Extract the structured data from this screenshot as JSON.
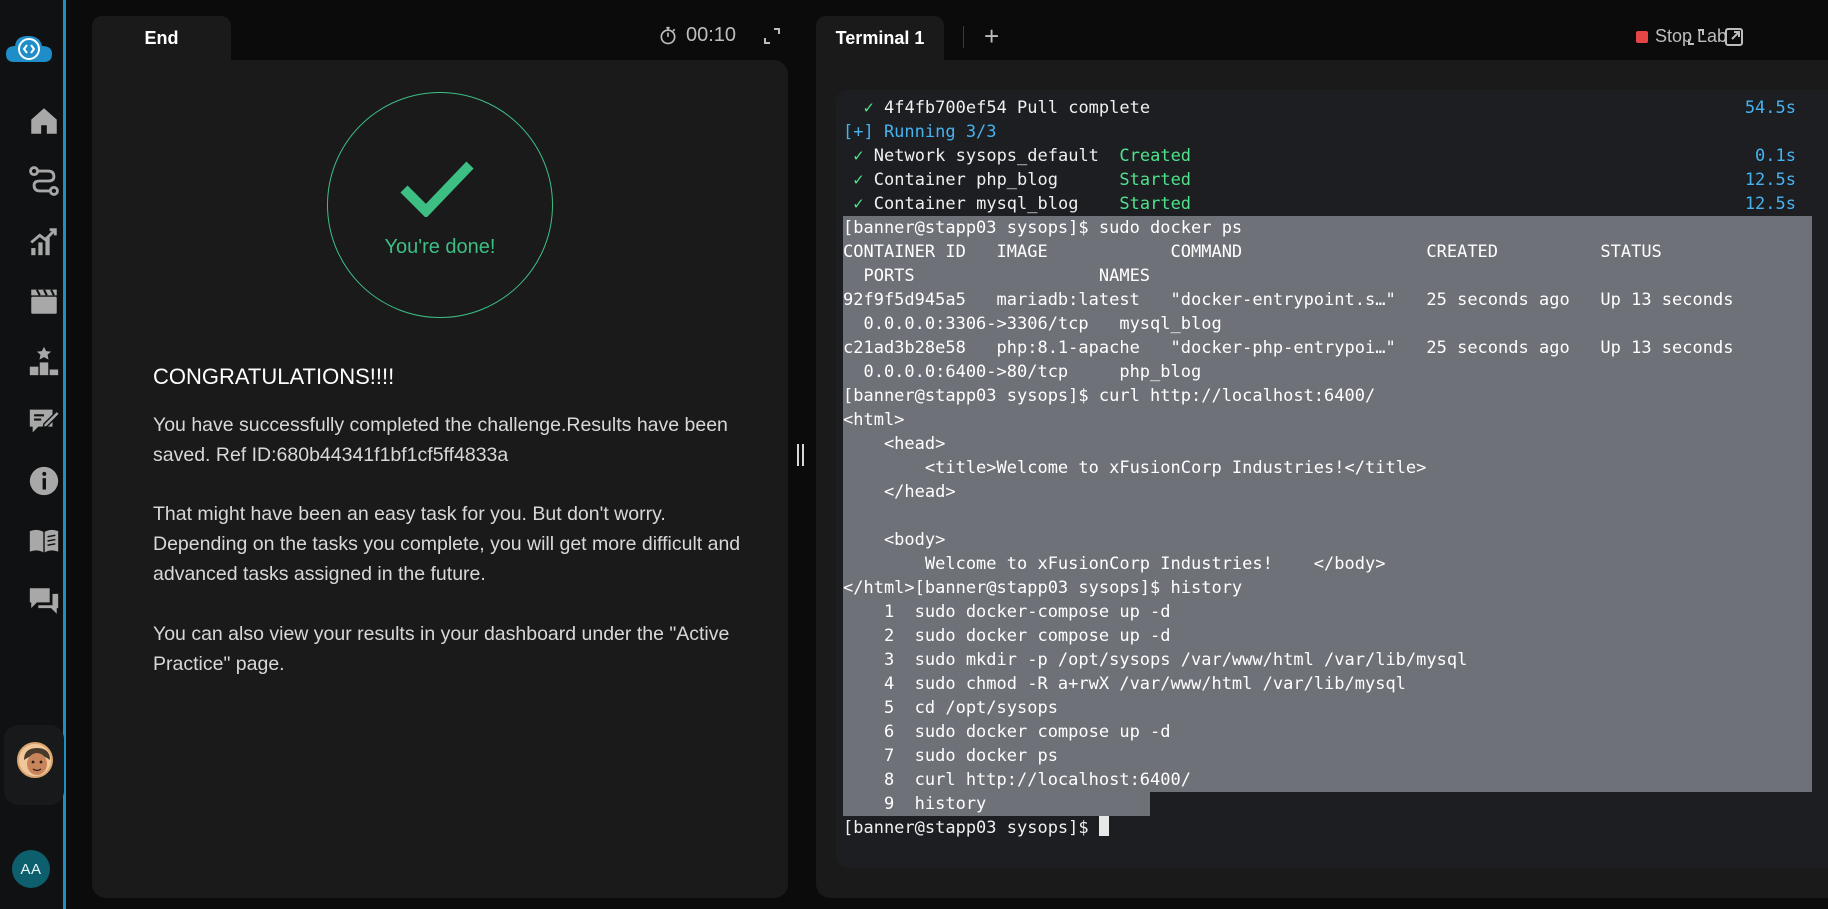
{
  "sidebar": {
    "items": [
      {
        "icon": "home-icon"
      },
      {
        "icon": "route-icon"
      },
      {
        "icon": "growth-chart-icon"
      },
      {
        "icon": "clapperboard-icon"
      },
      {
        "icon": "leaderboard-icon"
      },
      {
        "icon": "edit-note-icon"
      },
      {
        "icon": "info-icon"
      },
      {
        "icon": "book-icon"
      },
      {
        "icon": "chat-icon"
      }
    ],
    "user_initials": "AA",
    "accent_color": "#1f8ec8"
  },
  "left": {
    "tab_label": "End",
    "timer": "00:10",
    "done_text": "You're done!",
    "heading": "CONGRATULATIONS!!!!",
    "paragraphs": [
      "You have successfully completed the challenge.Results have been saved. Ref ID:680b44341f1bf1cf5ff4833a",
      "That might have been an easy task for you. But don't worry. Depending on the tasks you complete, you will get more difficult and advanced tasks assigned in the future.",
      "You can also view your results in your dashboard under the \"Active Practice\" page."
    ],
    "accent_color": "#3dbf84"
  },
  "right": {
    "tab_label": "Terminal 1",
    "add_tab": "+",
    "stop_label": "Stop Lab"
  },
  "terminal": {
    "pull": {
      "check": "✓",
      "text": "4f4fb700ef54 Pull complete",
      "time": "54.5s"
    },
    "running": "[+] Running 3/3",
    "rows": [
      {
        "check": "✓",
        "text": "Network sysops_default  ",
        "status": "Created",
        "time": "0.1s"
      },
      {
        "check": "✓",
        "text": "Container php_blog      ",
        "status": "Started",
        "time": "12.5s"
      },
      {
        "check": "✓",
        "text": "Container mysql_blog    ",
        "status": "Started",
        "time": "12.5s"
      }
    ],
    "selected_lines": [
      "[banner@stapp03 sysops]$ sudo docker ps",
      "CONTAINER ID   IMAGE            COMMAND                  CREATED          STATUS",
      "  PORTS                  NAMES",
      "92f9f5d945a5   mariadb:latest   \"docker-entrypoint.s…\"   25 seconds ago   Up 13 seconds",
      "  0.0.0.0:3306->3306/tcp   mysql_blog",
      "c21ad3b28e58   php:8.1-apache   \"docker-php-entrypoi…\"   25 seconds ago   Up 13 seconds",
      "  0.0.0.0:6400->80/tcp     php_blog",
      "[banner@stapp03 sysops]$ curl http://localhost:6400/",
      "<html>",
      "    <head>",
      "        <title>Welcome to xFusionCorp Industries!</title>",
      "    </head>",
      "",
      "    <body>",
      "        Welcome to xFusionCorp Industries!    </body>",
      "</html>[banner@stapp03 sysops]$ history",
      "    1  sudo docker-compose up -d",
      "    2  sudo docker compose up -d",
      "    3  sudo mkdir -p /opt/sysops /var/www/html /var/lib/mysql",
      "    4  sudo chmod -R a+rwX /var/www/html /var/lib/mysql",
      "    5  cd /opt/sysops",
      "    6  sudo docker compose up -d",
      "    7  sudo docker ps",
      "    8  curl http://localhost:6400/"
    ],
    "last_selected": "    9  history",
    "prompt": "[banner@stapp03 sysops]$ "
  }
}
